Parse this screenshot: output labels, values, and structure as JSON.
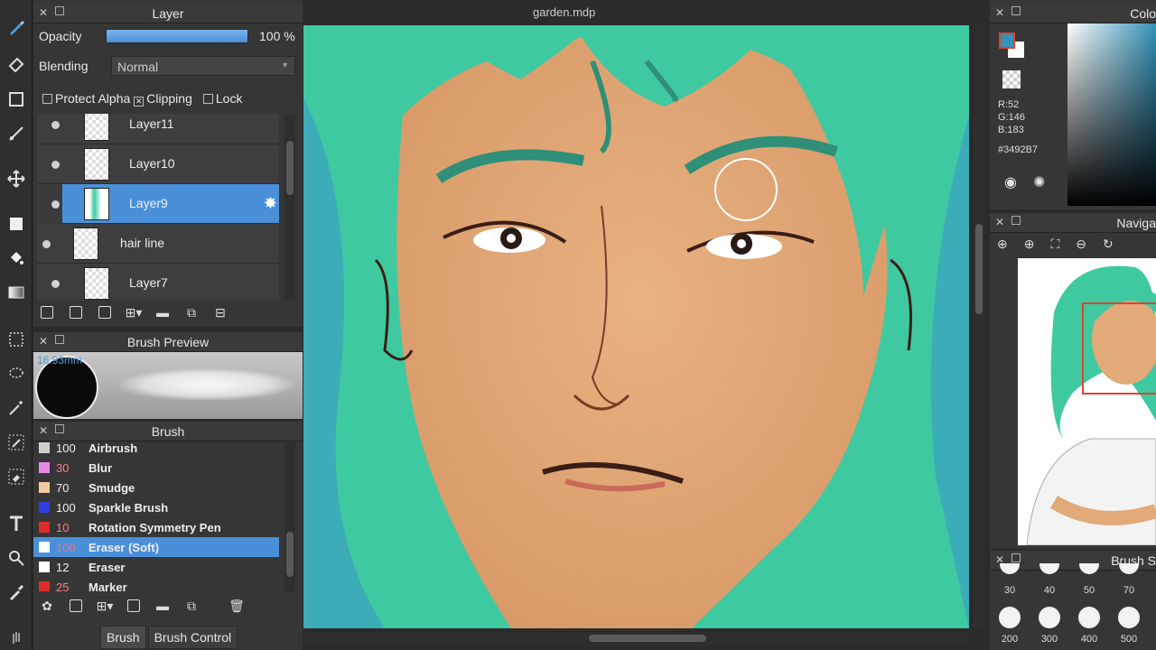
{
  "document": {
    "title": "garden.mdp"
  },
  "layer_panel": {
    "title": "Layer",
    "opacity_label": "Opacity",
    "opacity_value": "100 %",
    "opacity_fraction": 1.0,
    "blending_label": "Blending",
    "blending_value": "Normal",
    "protect_alpha": "Protect Alpha",
    "clipping": "Clipping",
    "lock": "Lock",
    "layers": [
      {
        "name": "Layer11",
        "selected": false
      },
      {
        "name": "Layer10",
        "selected": false
      },
      {
        "name": "Layer9",
        "selected": true
      },
      {
        "name": "hair line",
        "selected": false
      },
      {
        "name": "Layer7",
        "selected": false
      }
    ]
  },
  "brush_preview": {
    "title": "Brush Preview",
    "size": "16.93mm"
  },
  "brush_panel": {
    "title": "Brush",
    "items": [
      {
        "size": "100",
        "name": "Airbrush",
        "color": "#cfcfcf",
        "selected": false
      },
      {
        "size": "30",
        "name": "Blur",
        "color": "#e68ae6",
        "selected": false
      },
      {
        "size": "70",
        "name": "Smudge",
        "color": "#f3c9a6",
        "selected": false
      },
      {
        "size": "100",
        "name": "Sparkle Brush",
        "color": "#2f3fe0",
        "selected": false
      },
      {
        "size": "10",
        "name": "Rotation Symmetry Pen",
        "color": "#e02b2b",
        "selected": false
      },
      {
        "size": "100",
        "name": "Eraser (Soft)",
        "color": "#ffffff",
        "selected": true
      },
      {
        "size": "12",
        "name": "Eraser",
        "color": "#ffffff",
        "selected": false
      },
      {
        "size": "25",
        "name": "Marker",
        "color": "#e02b2b",
        "selected": false
      }
    ],
    "tabs": [
      "Brush",
      "Brush Control"
    ]
  },
  "color_panel": {
    "title": "Colo",
    "r": "R:52",
    "g": "G:146",
    "b": "B:183",
    "hex": "#3492B7",
    "fg_color": "#3492b7"
  },
  "navigator": {
    "title": "Naviga"
  },
  "brush_size_panel": {
    "title": "Brush S",
    "sizes": [
      "30",
      "40",
      "50",
      "70",
      "200",
      "300",
      "400",
      "500"
    ]
  },
  "colors": {
    "accent": "#4a90d9",
    "hair": "#3fc9a0",
    "skin": "#e2a979"
  }
}
